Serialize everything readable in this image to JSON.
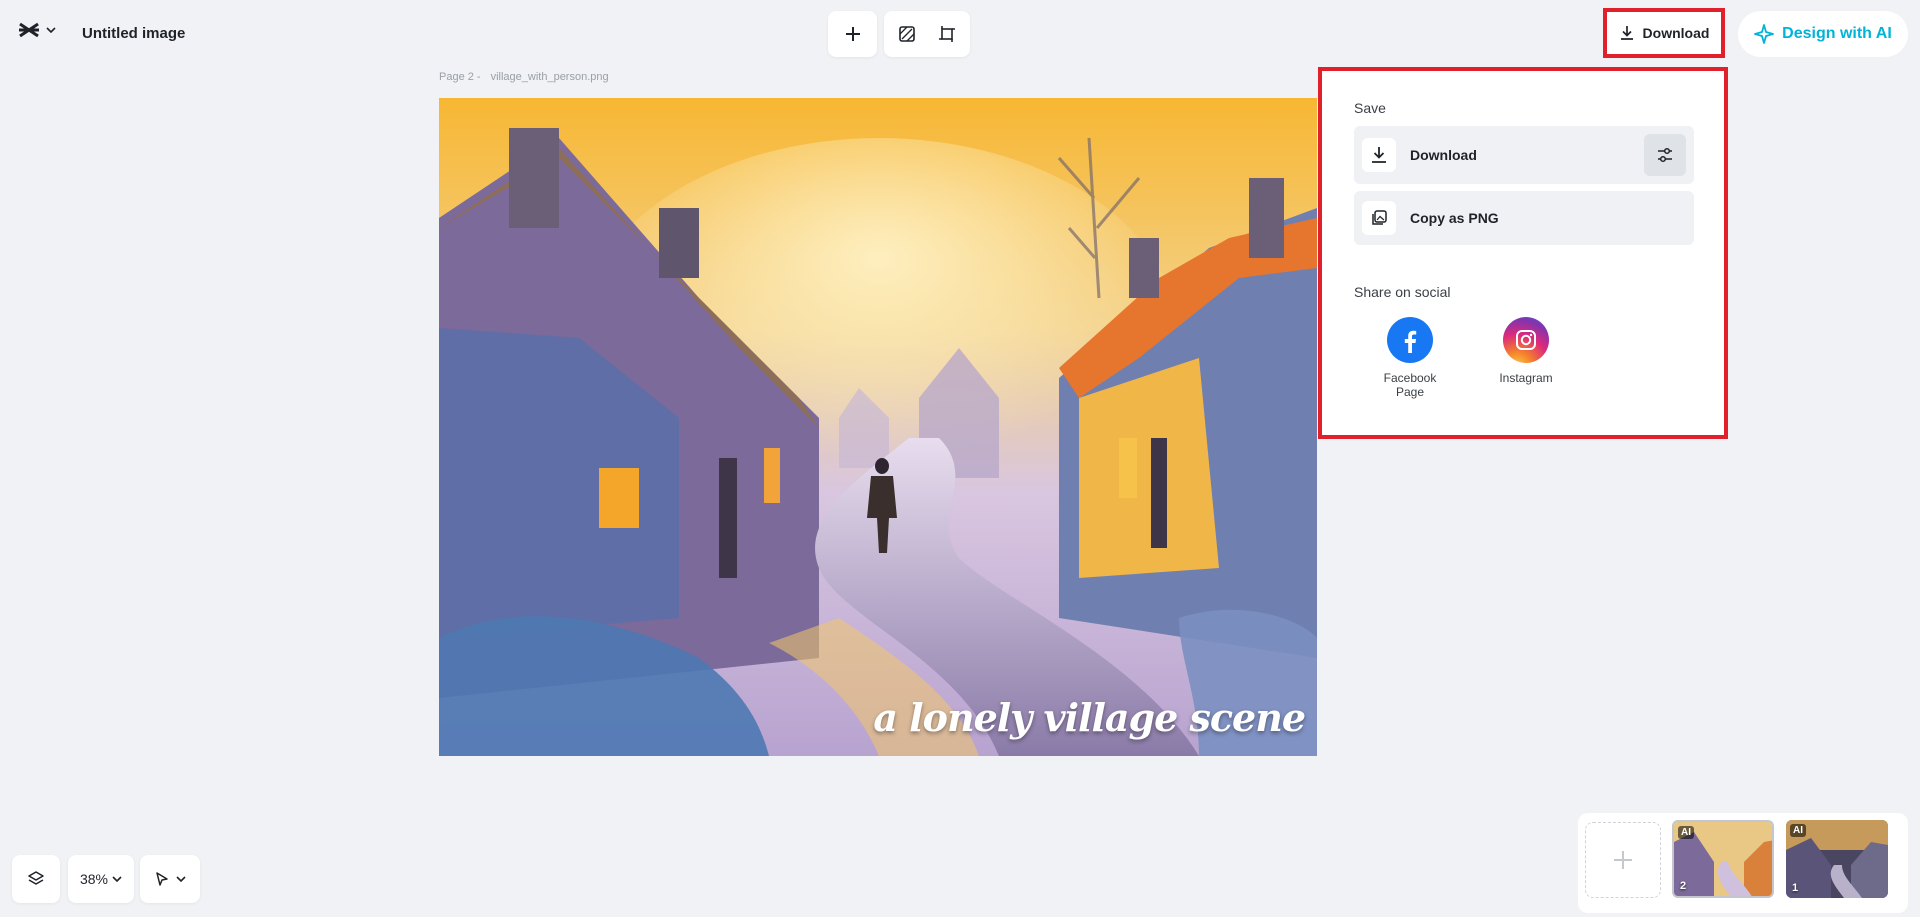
{
  "header": {
    "doc_title": "Untitled image",
    "download_label": "Download",
    "design_ai_label": "Design with AI"
  },
  "canvas": {
    "page_label": "Page 2 -",
    "file_name": "village_with_person.png",
    "image_caption": "a lonely village scene"
  },
  "download_panel": {
    "save_title": "Save",
    "download_label": "Download",
    "copy_label": "Copy as PNG",
    "share_title": "Share on social",
    "social": [
      {
        "label": "Facebook Page",
        "icon": "facebook-icon",
        "color": "#1877f2"
      },
      {
        "label": "Instagram",
        "icon": "instagram-icon",
        "color": "#e1306c"
      }
    ]
  },
  "bottom": {
    "zoom": "38%"
  },
  "thumbnails": [
    {
      "badge": "AI",
      "num": "2",
      "active": true
    },
    {
      "badge": "AI",
      "num": "1",
      "active": false
    }
  ],
  "colors": {
    "highlight": "#e0202a",
    "ai_accent": "#00b4d8",
    "background": "#f0f2f5"
  }
}
